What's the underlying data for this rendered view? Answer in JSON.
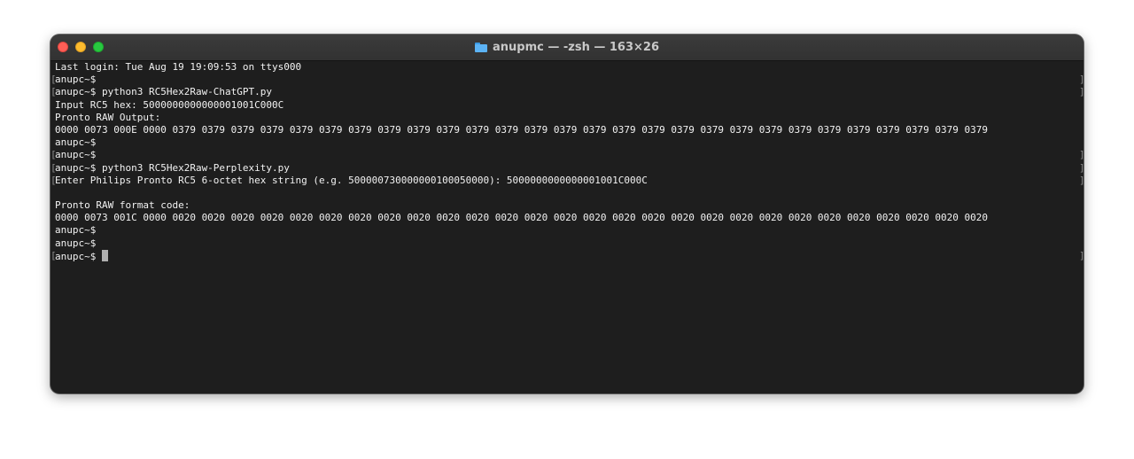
{
  "window": {
    "title": "anupmc — -zsh — 163×26",
    "title_icon": "folder-icon"
  },
  "terminal": {
    "lines": [
      {
        "text": "Last login: Tue Aug 19 19:09:53 on ttys000",
        "marked": false
      },
      {
        "text": "anupc~$",
        "marked": true
      },
      {
        "text": "anupc~$ python3 RC5Hex2Raw-ChatGPT.py",
        "marked": true
      },
      {
        "text": "Input RC5 hex: 5000000000000001001C000C",
        "marked": false
      },
      {
        "text": "Pronto RAW Output:",
        "marked": false
      },
      {
        "text": "0000 0073 000E 0000 0379 0379 0379 0379 0379 0379 0379 0379 0379 0379 0379 0379 0379 0379 0379 0379 0379 0379 0379 0379 0379 0379 0379 0379 0379 0379 0379 0379",
        "marked": false
      },
      {
        "text": "anupc~$",
        "marked": false
      },
      {
        "text": "anupc~$",
        "marked": true
      },
      {
        "text": "anupc~$ python3 RC5Hex2Raw-Perplexity.py",
        "marked": true
      },
      {
        "text": "Enter Philips Pronto RC5 6-octet hex string (e.g. 500000730000000100050000): 5000000000000001001C000C",
        "marked": true
      },
      {
        "text": "",
        "marked": false
      },
      {
        "text": "Pronto RAW format code:",
        "marked": false
      },
      {
        "text": "0000 0073 001C 0000 0020 0020 0020 0020 0020 0020 0020 0020 0020 0020 0020 0020 0020 0020 0020 0020 0020 0020 0020 0020 0020 0020 0020 0020 0020 0020 0020 0020",
        "marked": false
      },
      {
        "text": "anupc~$",
        "marked": false
      },
      {
        "text": "anupc~$",
        "marked": false
      },
      {
        "text": "anupc~$ ",
        "marked": true,
        "cursor": true
      }
    ]
  }
}
